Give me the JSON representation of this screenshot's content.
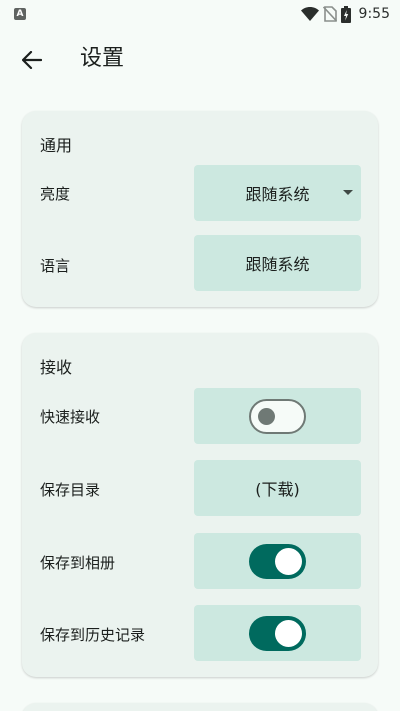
{
  "status_bar": {
    "notification_icon": "A",
    "icons": [
      "wifi-icon",
      "no-sim-icon",
      "battery-icon"
    ],
    "time": "9:55"
  },
  "app_bar": {
    "back_icon": "arrow-left-icon",
    "title": "设置"
  },
  "general": {
    "title": "通用",
    "brightness_label": "亮度",
    "brightness_value": "跟随系统",
    "language_label": "语言",
    "language_value": "跟随系统"
  },
  "receive": {
    "title": "接收",
    "quick_receive_label": "快速接收",
    "quick_receive_on": false,
    "save_dir_label": "保存目录",
    "save_dir_value": "(下载)",
    "save_to_album_label": "保存到相册",
    "save_to_album_on": true,
    "save_to_history_label": "保存到历史记录",
    "save_to_history_on": true
  },
  "colors": {
    "background": "#f6fbf8",
    "card": "#ebf3ef",
    "control": "#cce8e0",
    "switch_on": "#006a5e",
    "switch_off_outline": "#6f7975"
  }
}
